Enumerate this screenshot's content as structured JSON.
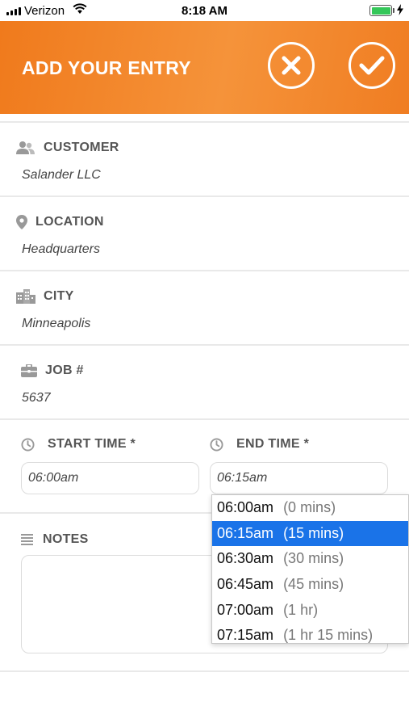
{
  "status_bar": {
    "carrier": "Verizon",
    "time": "8:18 AM"
  },
  "header": {
    "title": "ADD YOUR ENTRY"
  },
  "fields": {
    "customer": {
      "label": "CUSTOMER",
      "value": "Salander LLC"
    },
    "location": {
      "label": "LOCATION",
      "value": "Headquarters"
    },
    "city": {
      "label": "CITY",
      "value": "Minneapolis"
    },
    "job": {
      "label": "JOB #",
      "value": "5637"
    }
  },
  "start_time": {
    "label": "START TIME *",
    "value": "06:00am"
  },
  "end_time": {
    "label": "END TIME *",
    "value": "06:15am"
  },
  "notes": {
    "label": "NOTES",
    "value": ""
  },
  "end_time_options": [
    {
      "time": "06:00am",
      "duration": "(0 mins)"
    },
    {
      "time": "06:15am",
      "duration": "(15 mins)"
    },
    {
      "time": "06:30am",
      "duration": "(30 mins)"
    },
    {
      "time": "06:45am",
      "duration": "(45 mins)"
    },
    {
      "time": "07:00am",
      "duration": "(1 hr)"
    },
    {
      "time": "07:15am",
      "duration": "(1 hr 15 mins)"
    }
  ],
  "selected_end_option": "06:15am",
  "colors": {
    "header_orange": "#f5933a",
    "selection_blue": "#1a73e8",
    "battery_green": "#34c759"
  },
  "icons": {
    "customer": "users-icon",
    "location": "map-pin-icon",
    "city": "buildings-icon",
    "job": "briefcase-icon",
    "time": "clock-icon",
    "notes": "lines-icon",
    "cancel": "close-icon",
    "save": "checkmark-icon"
  }
}
